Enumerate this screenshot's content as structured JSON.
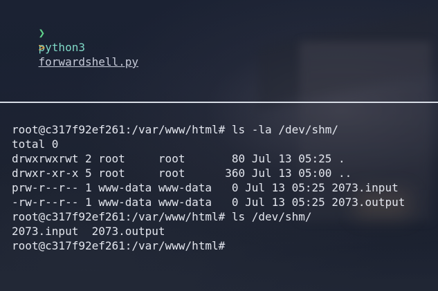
{
  "top_pane": {
    "prompt_symbol": "❯",
    "command": "python3",
    "argument": "forwardshell.py",
    "continuation_symbol": ">"
  },
  "bottom_pane": {
    "lines": [
      "root@c317f92ef261:/var/www/html# ls -la /dev/shm/",
      "total 0",
      "drwxrwxrwt 2 root     root       80 Jul 13 05:25 .",
      "drwxr-xr-x 5 root     root      360 Jul 13 05:00 ..",
      "prw-r--r-- 1 www-data www-data   0 Jul 13 05:25 2073.input",
      "-rw-r--r-- 1 www-data www-data   0 Jul 13 05:25 2073.output",
      "root@c317f92ef261:/var/www/html# ls /dev/shm/",
      "2073.input  2073.output",
      "root@c317f92ef261:/var/www/html#"
    ]
  },
  "colors": {
    "prompt_green": "#5fd38a",
    "command_teal": "#7fd8c6",
    "continuation_orange": "#e5a645",
    "text": "#e3e6ee",
    "divider": "#d8dde6"
  }
}
